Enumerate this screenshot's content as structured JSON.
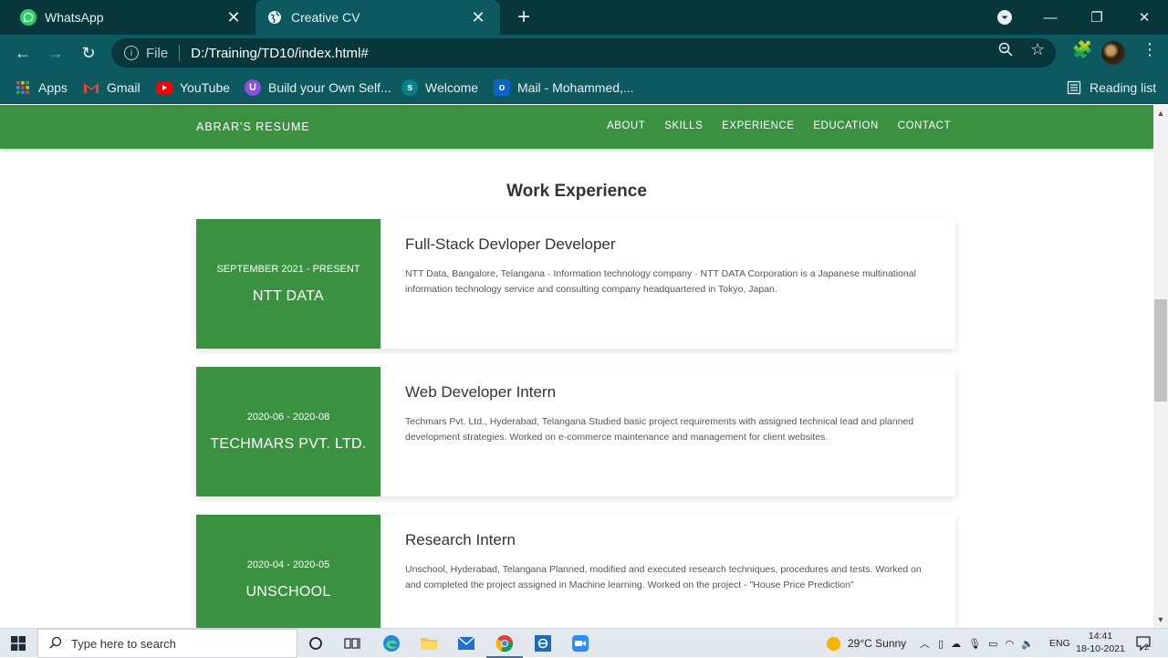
{
  "browser": {
    "tabs": [
      {
        "title": "WhatsApp",
        "active": false
      },
      {
        "title": "Creative CV",
        "active": true
      }
    ],
    "address": {
      "scheme_label": "File",
      "url": "D:/Training/TD10/index.html#"
    },
    "bookmarks": [
      {
        "label": "Apps",
        "icon": "apps-grid-icon"
      },
      {
        "label": "Gmail",
        "icon": "gmail-icon"
      },
      {
        "label": "YouTube",
        "icon": "youtube-icon"
      },
      {
        "label": "Build your Own Self...",
        "icon": "unschool-icon"
      },
      {
        "label": "Welcome",
        "icon": "sharepoint-icon"
      },
      {
        "label": "Mail - Mohammed,...",
        "icon": "outlook-icon"
      }
    ],
    "reading_list": "Reading list",
    "colors": {
      "tabstrip": "#07363b",
      "toolbar": "#0c5960"
    }
  },
  "site": {
    "brand": "ABRAR'S RESUME",
    "nav": [
      "ABOUT",
      "SKILLS",
      "EXPERIENCE",
      "EDUCATION",
      "CONTACT"
    ],
    "accent": "#3a9140",
    "section_title": "Work Experience",
    "experience": [
      {
        "date": "SEPTEMBER 2021 - PRESENT",
        "company": "NTT DATA",
        "role": "Full-Stack Devloper Developer",
        "description": "NTT Data, Bangalore, Telangana · Information technology company · NTT DATA Corporation is a Japanese multinational information technology service and consulting company headquartered in Tokyo, Japan."
      },
      {
        "date": "2020-06 - 2020-08",
        "company": "TECHMARS PVT. LTD.",
        "role": "Web Developer Intern",
        "description": "Techmars Pvt. Ltd., Hyderabad, Telangana Studied basic project requirements with assigned technical lead and planned development strategies. Worked on e-commerce maintenance and management for client websites."
      },
      {
        "date": "2020-04 - 2020-05",
        "company": "UNSCHOOL",
        "role": "Research Intern",
        "description": "Unschool, Hyderabad, Telangana Planned, modified and executed research techniques, procedures and tests. Worked on and completed the project assigned in Machine learning. Worked on the project - \"House Price Prediction\""
      }
    ]
  },
  "taskbar": {
    "search_placeholder": "Type here to search",
    "weather": "29°C  Sunny",
    "language": "ENG",
    "time": "14:41",
    "date": "18-10-2021",
    "notification_count": "2"
  }
}
